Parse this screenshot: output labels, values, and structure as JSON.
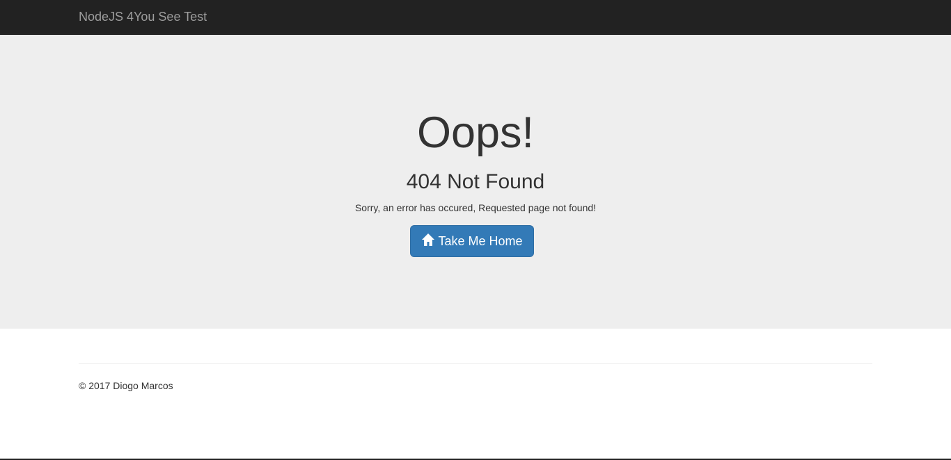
{
  "navbar": {
    "brand": "NodeJS 4You See Test",
    "background": "#222222"
  },
  "error": {
    "heading": "Oops!",
    "status": "404 Not Found",
    "message": "Sorry, an error has occured, Requested page not found!",
    "home_button": {
      "label": "Take Me Home",
      "icon": "home-icon",
      "color": "#337ab7"
    }
  },
  "footer": {
    "copyright": "© 2017 Diogo Marcos"
  }
}
